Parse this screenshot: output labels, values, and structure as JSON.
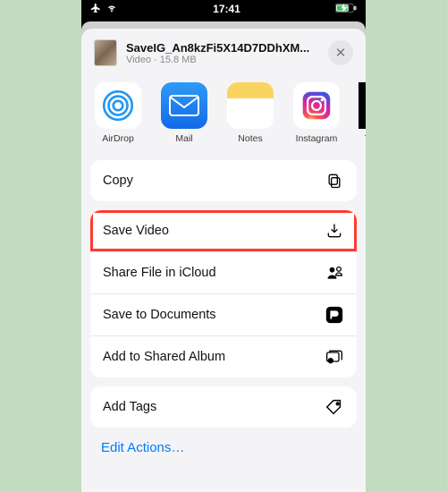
{
  "status": {
    "time": "17:41"
  },
  "file": {
    "name": "SaveIG_An8kzFi5X14D7DDhXM...",
    "type": "Video",
    "size": "15.8 MB"
  },
  "apps": {
    "airdrop": "AirDrop",
    "mail": "Mail",
    "notes": "Notes",
    "instagram": "Instagram",
    "tiktok": "T"
  },
  "actions": {
    "copy": "Copy",
    "save_video": "Save Video",
    "share_icloud": "Share File in iCloud",
    "save_docs": "Save to Documents",
    "shared_album": "Add to Shared Album",
    "add_tags": "Add Tags"
  },
  "edit": "Edit Actions…"
}
